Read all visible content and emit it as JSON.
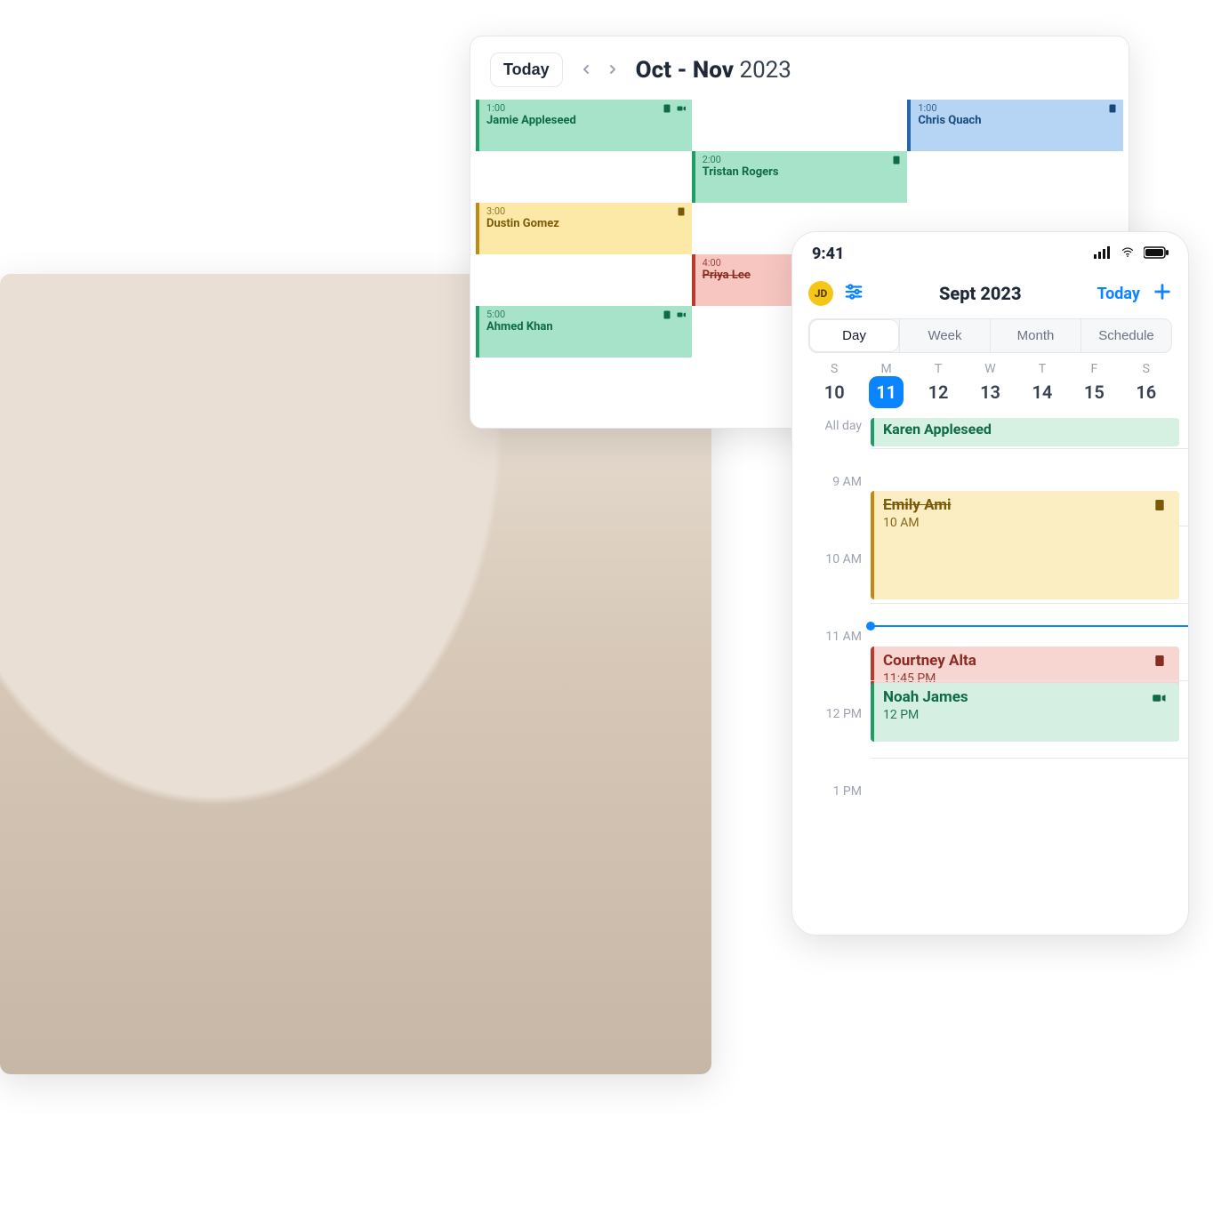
{
  "hero": {},
  "desktop": {
    "today_btn": "Today",
    "title_range": "Oct - Nov",
    "title_year": "2023",
    "events": {
      "jamie": {
        "time": "1:00",
        "name": "Jamie Appleseed"
      },
      "chris": {
        "time": "1:00",
        "name": "Chris Quach"
      },
      "tristan": {
        "time": "2:00",
        "name": "Tristan Rogers"
      },
      "dustin": {
        "time": "3:00",
        "name": "Dustin Gomez"
      },
      "priya": {
        "time": "4:00",
        "name": "Priya Lee"
      },
      "ahmed": {
        "time": "5:00",
        "name": "Ahmed Khan"
      }
    }
  },
  "mobile": {
    "status_time": "9:41",
    "avatar_initials": "JD",
    "title": "Sept 2023",
    "today_link": "Today",
    "tabs": {
      "day": "Day",
      "week": "Week",
      "month": "Month",
      "schedule": "Schedule"
    },
    "dow": [
      "S",
      "M",
      "T",
      "W",
      "T",
      "F",
      "S"
    ],
    "nums": [
      "10",
      "11",
      "12",
      "13",
      "14",
      "15",
      "16"
    ],
    "selected_index": 1,
    "allday_label": "All day",
    "hours": [
      "9 AM",
      "10 AM",
      "11 AM",
      "12 PM",
      "1 PM"
    ],
    "events": {
      "karen": {
        "name": "Karen Appleseed"
      },
      "emily": {
        "name": "Emily Ami",
        "sub": "10 AM"
      },
      "courtney": {
        "name": "Courtney Alta",
        "sub": "11:45 PM"
      },
      "noah": {
        "name": "Noah James",
        "sub": "12 PM"
      }
    }
  }
}
